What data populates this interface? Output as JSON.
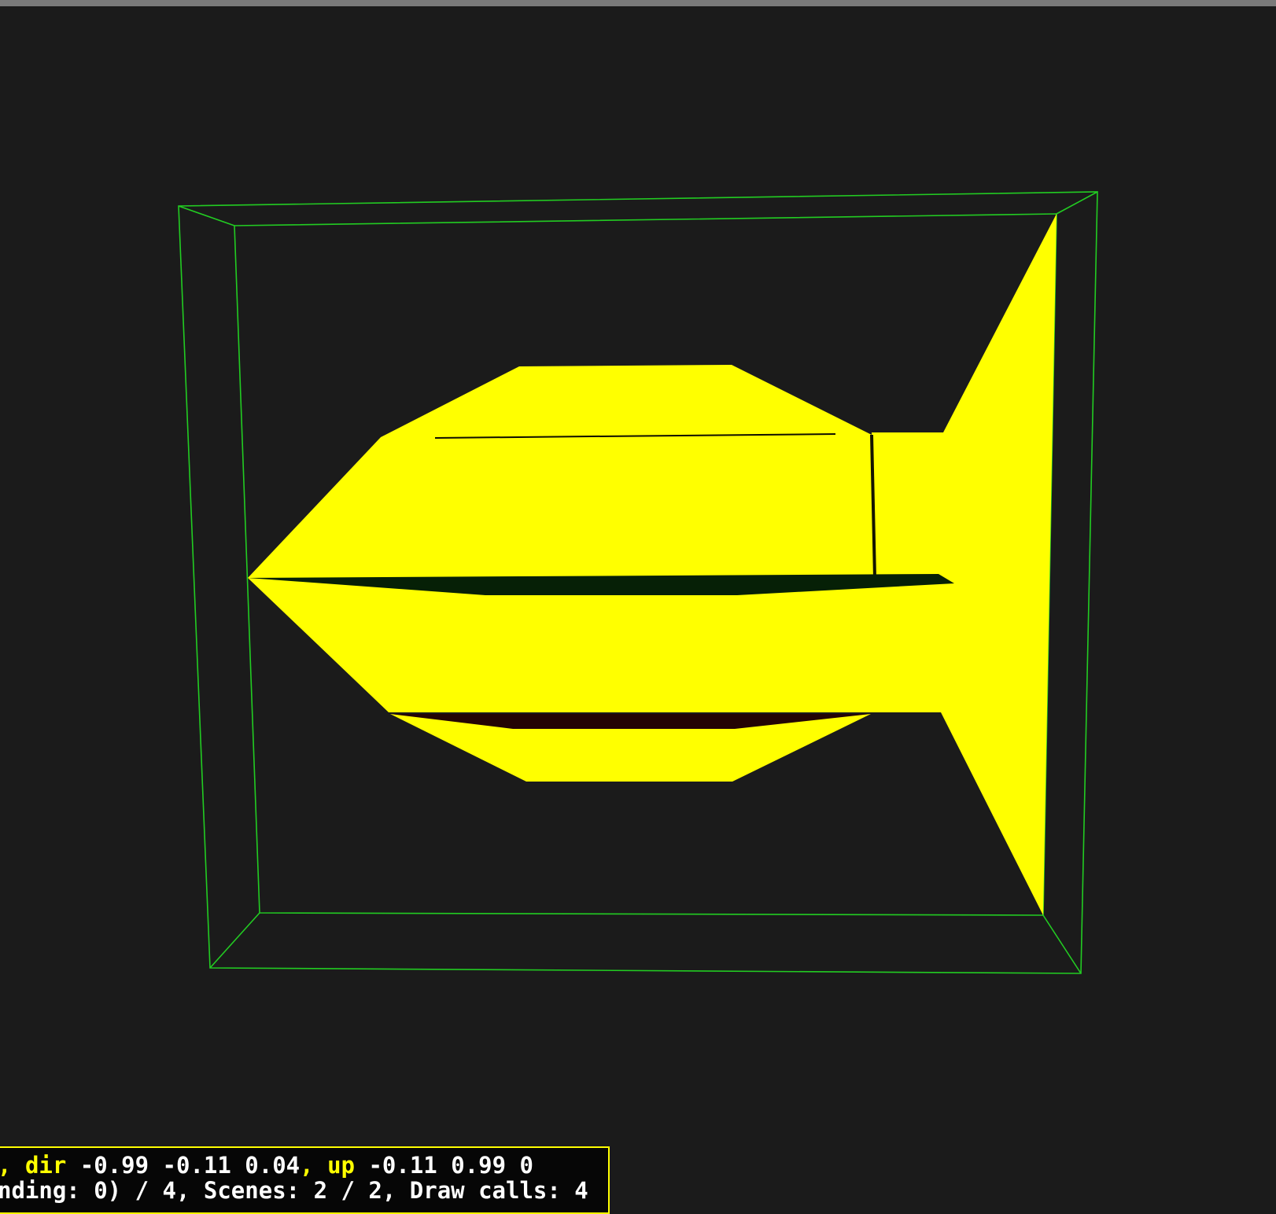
{
  "colors": {
    "background": "#1b1b1b",
    "bounding_box": "#22cc22",
    "model_fill": "#ffff00",
    "shadow_green": "#062006",
    "shadow_red": "#240404",
    "hud_border": "#ffff00",
    "hud_keyword": "#ffff00",
    "hud_text": "#ffffff"
  },
  "hud": {
    "line1": {
      "lead": ",",
      "dir_label": "dir",
      "dir_value": " -0.99 -0.11 0.04",
      "sep": ",",
      "up_label": "up",
      "up_value": " -0.11 0.99 0"
    },
    "line2": "nding: 0) / 4, Scenes: 2 / 2, Draw calls: 4"
  }
}
